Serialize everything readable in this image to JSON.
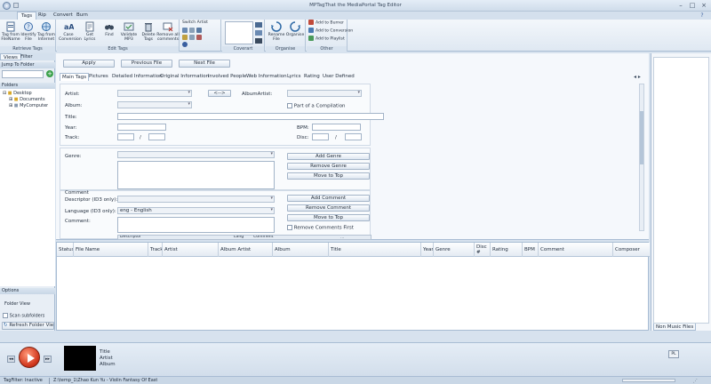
{
  "app": {
    "title": "MPTagThat the MediaPortal Tag Editor"
  },
  "ribbon": {
    "tabs": [
      "Tags",
      "Rip",
      "Convert",
      "Burn"
    ],
    "groups": {
      "retrieve_tags": {
        "label": "Retrieve Tags",
        "buttons": [
          "Tag from FileName",
          "Identify File",
          "Tag from Internet"
        ]
      },
      "edit_tags": {
        "label": "Edit Tags",
        "buttons": [
          "Case Conversion",
          "Get Lyrics",
          "Find",
          "Validate MP3",
          "Delete Tags",
          "Remove all comments"
        ]
      },
      "switch_artist": "Switch Artist",
      "coverart": {
        "label": "Coverart"
      },
      "organise": {
        "label": "Organise",
        "buttons": [
          "Rename File",
          "Organise"
        ]
      },
      "other": {
        "label": "Other",
        "items": [
          "Add to Burner",
          "Add to Conversion",
          "Add to Playlist"
        ]
      }
    }
  },
  "left_panel": {
    "tabs": [
      "Views",
      "Filter"
    ],
    "jump_label": "Jump To Folder",
    "folders_label": "Folders",
    "tree": [
      "Desktop",
      "Documents",
      "MyComputer"
    ],
    "options_label": "Options",
    "folder_view": "Folder View",
    "scan_subfolders": "Scan subfolders",
    "refresh": "Refresh Folder Vie"
  },
  "editor": {
    "apply": "Apply",
    "previous": "Previous File",
    "next": "Next File",
    "subtabs": [
      "Main Tags",
      "Pictures",
      "Detailed Information",
      "Original Information",
      "Involved People",
      "Web Information",
      "Lyrics",
      "Rating",
      "User Defined"
    ],
    "labels": {
      "artist": "Artist:",
      "album_artist": "AlbumArtist:",
      "album": "Album:",
      "compilation": "Part of a Compilation",
      "title": "Title:",
      "year": "Year:",
      "bpm": "BPM:",
      "track": "Track:",
      "disc": "Disc:",
      "slash": "/",
      "genre": "Genre:",
      "comment_header": "Comment",
      "descriptor": "Descriptor (ID3 only):",
      "language": "Language (ID3 only):",
      "comment": "Comment:"
    },
    "swap_button": "<-->",
    "language_value": "eng - English",
    "genre_buttons": [
      "Add Genre",
      "Remove Genre",
      "Move to Top"
    ],
    "comment_buttons": [
      "Add Comment",
      "Remove Comment",
      "Move to Top"
    ],
    "remove_comments_first": "Remove Comments First",
    "comment_list_cols": [
      "Descriptor",
      "Lang",
      "Comment"
    ]
  },
  "grid": {
    "columns": [
      "Status",
      "File Name",
      "Track",
      "Artist",
      "Album Artist",
      "Album",
      "Title",
      "Year",
      "Genre",
      "Disc #",
      "Rating",
      "BPM",
      "Comment",
      "Composer"
    ]
  },
  "right_panel": {
    "tab": "Non Music Files"
  },
  "player": {
    "title": "Title",
    "artist": "Artist",
    "album": "Album",
    "playlist_button": "PL"
  },
  "status": {
    "tagfilter": "TagFilter: Inactive",
    "path": "Z:\\temp_1\\Zhao Kun Yu - Violin Fantasy Of East"
  }
}
